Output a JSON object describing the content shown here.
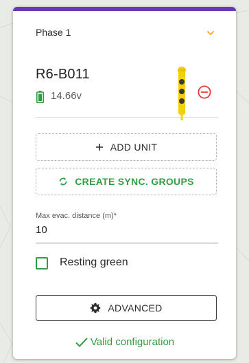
{
  "phase": {
    "title": "Phase 1"
  },
  "unit": {
    "name": "R6-B011",
    "voltage": "14.66v"
  },
  "actions": {
    "add_unit_label": "ADD UNIT",
    "sync_groups_label": "CREATE SYNC. GROUPS",
    "advanced_label": "ADVANCED"
  },
  "evac_field": {
    "label": "Max evac. distance (m)*",
    "value": "10"
  },
  "resting": {
    "label": "Resting green",
    "checked": false
  },
  "status": {
    "text": "Valid configuration"
  },
  "icons": {
    "expand": "chevron-down-icon",
    "battery": "battery-full-icon",
    "device": "traffic-light-icon",
    "remove": "remove-circle-icon",
    "add": "plus-icon",
    "sync": "sync-icon",
    "settings": "gear-icon",
    "valid": "check-icon"
  },
  "colors": {
    "accent": "#673ab7",
    "chevron": "#f5a623",
    "battery": "#2e9e42",
    "device_body": "#f2d10a",
    "device_lamp": "#3b3b2f",
    "remove": "#e53935",
    "success": "#2e9e42"
  }
}
